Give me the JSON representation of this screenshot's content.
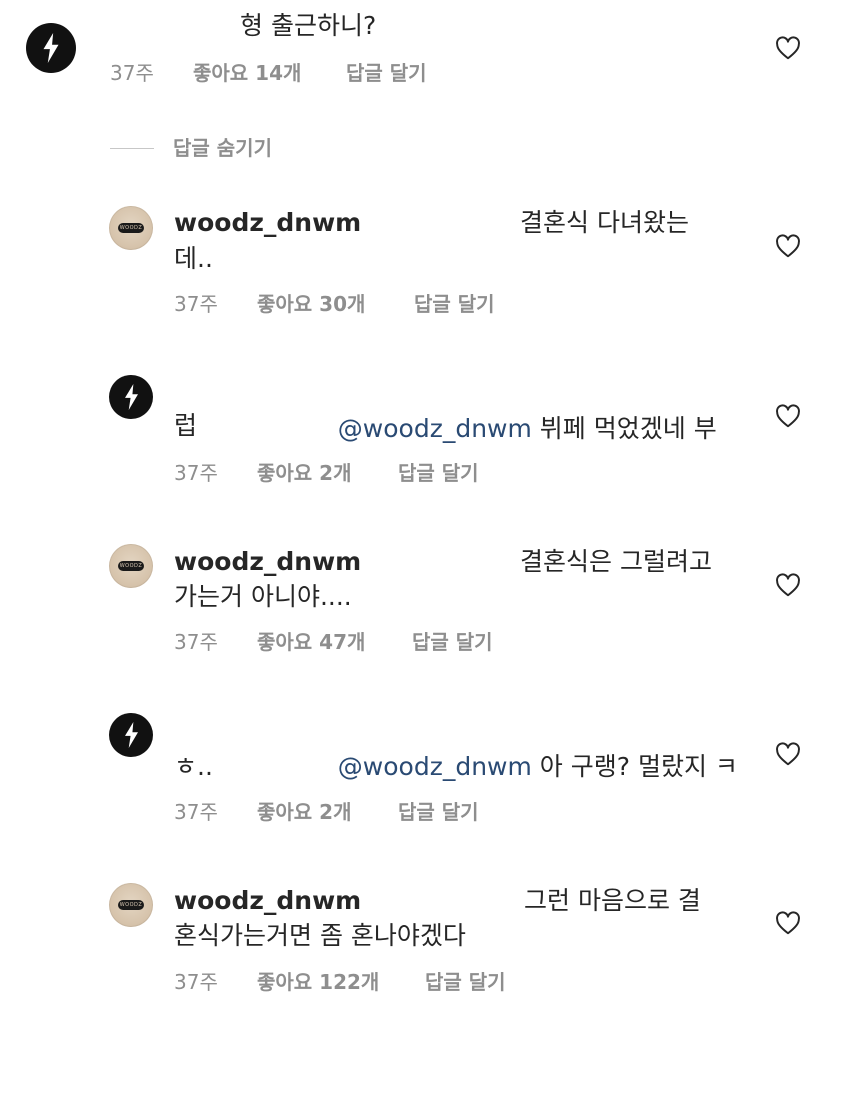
{
  "comments": [
    {
      "username": "",
      "line1": "형 출근하니?",
      "line2": "",
      "time": "37주",
      "likes": "좋아요 14개",
      "reply": "답글 달기"
    },
    {
      "username": "woodz_dnwm",
      "line1": "결혼식 다녀왔는",
      "line2": "데..",
      "time": "37주",
      "likes": "좋아요 30개",
      "reply": "답글 달기"
    },
    {
      "username": "",
      "mention": "@woodz_dnwm",
      "line1": "뷔페 먹었겠네 부",
      "line2": "럽",
      "time": "37주",
      "likes": "좋아요 2개",
      "reply": "답글 달기"
    },
    {
      "username": "woodz_dnwm",
      "line1": "결혼식은 그럴려고",
      "line2": "가는거 아니야....",
      "time": "37주",
      "likes": "좋아요 47개",
      "reply": "답글 달기"
    },
    {
      "username": "",
      "mention": "@woodz_dnwm",
      "line1": "아 구랭? 멀랐지 ㅋ",
      "line2": "ㅎ..",
      "time": "37주",
      "likes": "좋아요 2개",
      "reply": "답글 달기"
    },
    {
      "username": "woodz_dnwm",
      "line1": "그런 마음으로 결",
      "line2": "혼식가는거면 좀 혼나야겠다",
      "time": "37주",
      "likes": "좋아요 122개",
      "reply": "답글 달기"
    }
  ],
  "hide_replies": "답글 숨기기",
  "avatar_badge": "WOODZ",
  "icons": {
    "bolt": "lightning-bolt-icon",
    "heart": "heart-outline-icon"
  },
  "colors": {
    "text": "#262626",
    "meta": "#8e8e8e",
    "mention": "#2a4a73",
    "bolt_avatar_bg": "#111111",
    "woodz_avatar_bg": "#d6c3ab"
  }
}
